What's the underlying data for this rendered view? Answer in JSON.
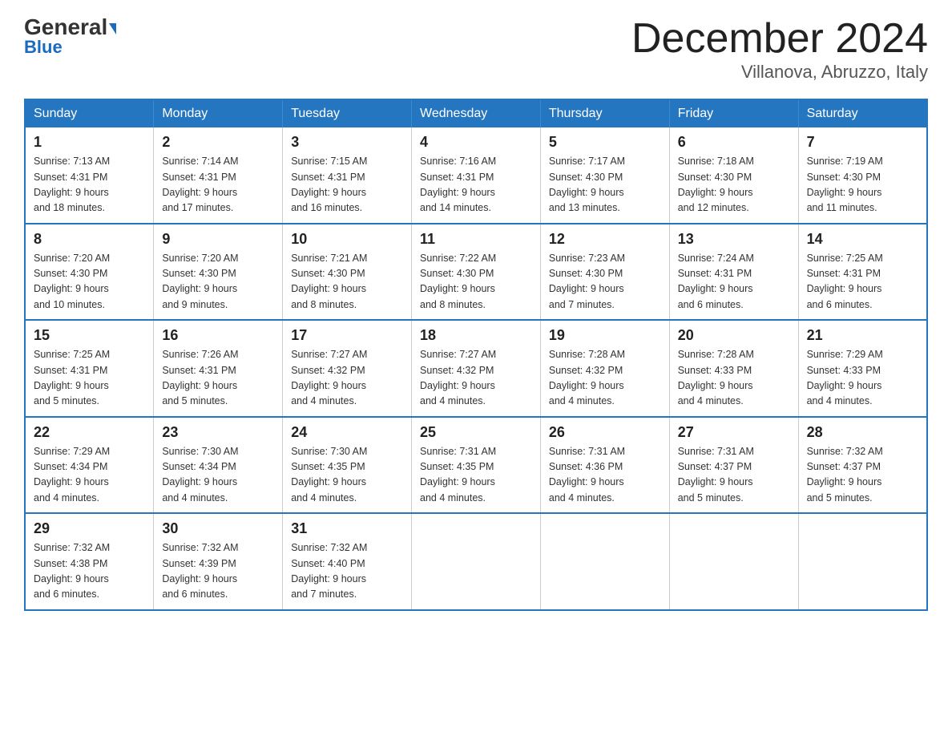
{
  "header": {
    "logo_main": "General",
    "logo_sub": "Blue",
    "title": "December 2024",
    "subtitle": "Villanova, Abruzzo, Italy"
  },
  "days_of_week": [
    "Sunday",
    "Monday",
    "Tuesday",
    "Wednesday",
    "Thursday",
    "Friday",
    "Saturday"
  ],
  "weeks": [
    [
      {
        "day": "1",
        "sunrise": "7:13 AM",
        "sunset": "4:31 PM",
        "daylight": "9 hours and 18 minutes."
      },
      {
        "day": "2",
        "sunrise": "7:14 AM",
        "sunset": "4:31 PM",
        "daylight": "9 hours and 17 minutes."
      },
      {
        "day": "3",
        "sunrise": "7:15 AM",
        "sunset": "4:31 PM",
        "daylight": "9 hours and 16 minutes."
      },
      {
        "day": "4",
        "sunrise": "7:16 AM",
        "sunset": "4:31 PM",
        "daylight": "9 hours and 14 minutes."
      },
      {
        "day": "5",
        "sunrise": "7:17 AM",
        "sunset": "4:30 PM",
        "daylight": "9 hours and 13 minutes."
      },
      {
        "day": "6",
        "sunrise": "7:18 AM",
        "sunset": "4:30 PM",
        "daylight": "9 hours and 12 minutes."
      },
      {
        "day": "7",
        "sunrise": "7:19 AM",
        "sunset": "4:30 PM",
        "daylight": "9 hours and 11 minutes."
      }
    ],
    [
      {
        "day": "8",
        "sunrise": "7:20 AM",
        "sunset": "4:30 PM",
        "daylight": "9 hours and 10 minutes."
      },
      {
        "day": "9",
        "sunrise": "7:20 AM",
        "sunset": "4:30 PM",
        "daylight": "9 hours and 9 minutes."
      },
      {
        "day": "10",
        "sunrise": "7:21 AM",
        "sunset": "4:30 PM",
        "daylight": "9 hours and 8 minutes."
      },
      {
        "day": "11",
        "sunrise": "7:22 AM",
        "sunset": "4:30 PM",
        "daylight": "9 hours and 8 minutes."
      },
      {
        "day": "12",
        "sunrise": "7:23 AM",
        "sunset": "4:30 PM",
        "daylight": "9 hours and 7 minutes."
      },
      {
        "day": "13",
        "sunrise": "7:24 AM",
        "sunset": "4:31 PM",
        "daylight": "9 hours and 6 minutes."
      },
      {
        "day": "14",
        "sunrise": "7:25 AM",
        "sunset": "4:31 PM",
        "daylight": "9 hours and 6 minutes."
      }
    ],
    [
      {
        "day": "15",
        "sunrise": "7:25 AM",
        "sunset": "4:31 PM",
        "daylight": "9 hours and 5 minutes."
      },
      {
        "day": "16",
        "sunrise": "7:26 AM",
        "sunset": "4:31 PM",
        "daylight": "9 hours and 5 minutes."
      },
      {
        "day": "17",
        "sunrise": "7:27 AM",
        "sunset": "4:32 PM",
        "daylight": "9 hours and 4 minutes."
      },
      {
        "day": "18",
        "sunrise": "7:27 AM",
        "sunset": "4:32 PM",
        "daylight": "9 hours and 4 minutes."
      },
      {
        "day": "19",
        "sunrise": "7:28 AM",
        "sunset": "4:32 PM",
        "daylight": "9 hours and 4 minutes."
      },
      {
        "day": "20",
        "sunrise": "7:28 AM",
        "sunset": "4:33 PM",
        "daylight": "9 hours and 4 minutes."
      },
      {
        "day": "21",
        "sunrise": "7:29 AM",
        "sunset": "4:33 PM",
        "daylight": "9 hours and 4 minutes."
      }
    ],
    [
      {
        "day": "22",
        "sunrise": "7:29 AM",
        "sunset": "4:34 PM",
        "daylight": "9 hours and 4 minutes."
      },
      {
        "day": "23",
        "sunrise": "7:30 AM",
        "sunset": "4:34 PM",
        "daylight": "9 hours and 4 minutes."
      },
      {
        "day": "24",
        "sunrise": "7:30 AM",
        "sunset": "4:35 PM",
        "daylight": "9 hours and 4 minutes."
      },
      {
        "day": "25",
        "sunrise": "7:31 AM",
        "sunset": "4:35 PM",
        "daylight": "9 hours and 4 minutes."
      },
      {
        "day": "26",
        "sunrise": "7:31 AM",
        "sunset": "4:36 PM",
        "daylight": "9 hours and 4 minutes."
      },
      {
        "day": "27",
        "sunrise": "7:31 AM",
        "sunset": "4:37 PM",
        "daylight": "9 hours and 5 minutes."
      },
      {
        "day": "28",
        "sunrise": "7:32 AM",
        "sunset": "4:37 PM",
        "daylight": "9 hours and 5 minutes."
      }
    ],
    [
      {
        "day": "29",
        "sunrise": "7:32 AM",
        "sunset": "4:38 PM",
        "daylight": "9 hours and 6 minutes."
      },
      {
        "day": "30",
        "sunrise": "7:32 AM",
        "sunset": "4:39 PM",
        "daylight": "9 hours and 6 minutes."
      },
      {
        "day": "31",
        "sunrise": "7:32 AM",
        "sunset": "4:40 PM",
        "daylight": "9 hours and 7 minutes."
      },
      null,
      null,
      null,
      null
    ]
  ],
  "labels": {
    "sunrise": "Sunrise: ",
    "sunset": "Sunset: ",
    "daylight": "Daylight: "
  }
}
